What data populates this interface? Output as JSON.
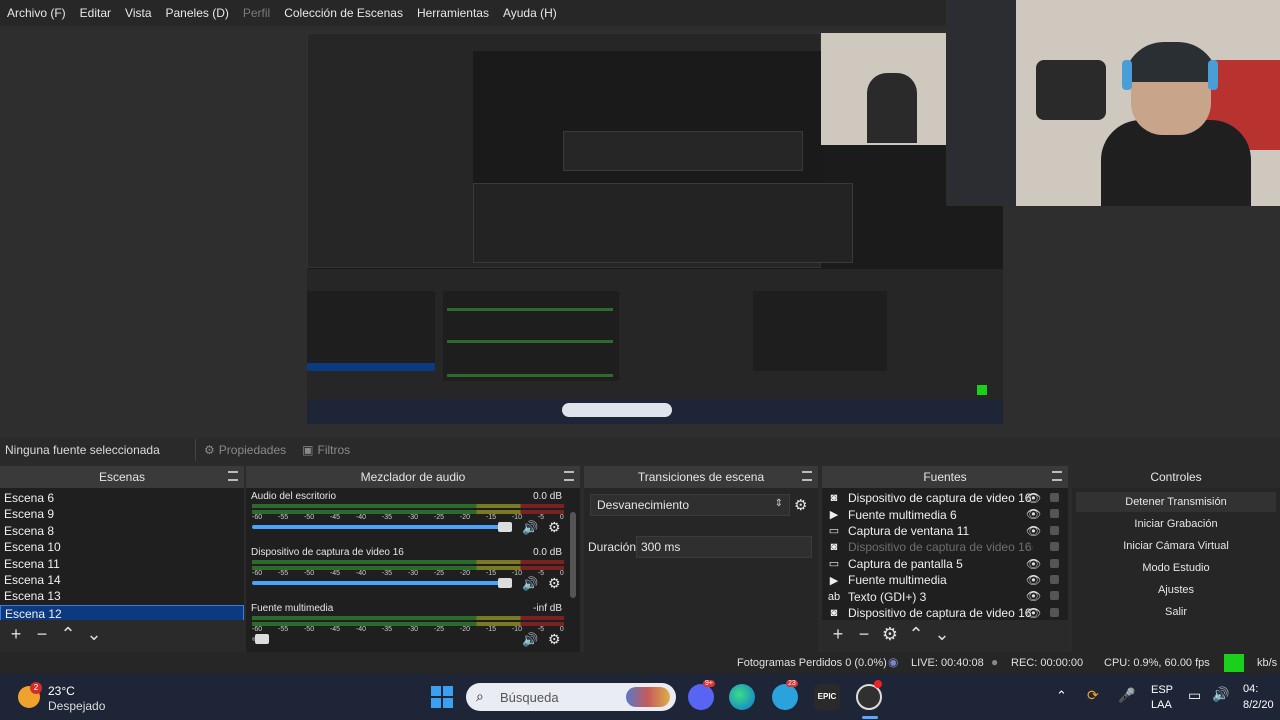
{
  "menubar": {
    "items": [
      {
        "label": "Archivo (F)",
        "disabled": false
      },
      {
        "label": "Editar",
        "disabled": false
      },
      {
        "label": "Vista",
        "disabled": false
      },
      {
        "label": "Paneles (D)",
        "disabled": false
      },
      {
        "label": "Perfil",
        "disabled": true
      },
      {
        "label": "Colección de Escenas",
        "disabled": false
      },
      {
        "label": "Herramientas",
        "disabled": false
      },
      {
        "label": "Ayuda (H)",
        "disabled": false
      }
    ]
  },
  "propbar": {
    "no_source": "Ninguna fuente seleccionada",
    "properties": "Propiedades",
    "filters": "Filtros"
  },
  "scenes": {
    "title": "Escenas",
    "items": [
      "Escena 6",
      "Escena 9",
      "Escena 8",
      "Escena 10",
      "Escena 11",
      "Escena 14",
      "Escena 13",
      "Escena 12"
    ],
    "selected": "Escena 12"
  },
  "mixer": {
    "title": "Mezclador de audio",
    "ticks": [
      "-60",
      "-55",
      "-50",
      "-45",
      "-40",
      "-35",
      "-30",
      "-25",
      "-20",
      "-15",
      "-10",
      "-5",
      "0"
    ],
    "channels": [
      {
        "name": "Audio del escritorio",
        "level": "0.0 dB",
        "volume_fraction": 1.0
      },
      {
        "name": "Dispositivo de captura de video 16",
        "level": "0.0 dB",
        "volume_fraction": 1.0
      },
      {
        "name": "Fuente multimedia",
        "level": "-inf dB",
        "volume_fraction": 0.05
      }
    ]
  },
  "transitions": {
    "title": "Transiciones de escena",
    "selected": "Desvanecimiento",
    "duration_label": "Duración",
    "duration_value": "300 ms"
  },
  "sources": {
    "title": "Fuentes",
    "items": [
      {
        "label": "Dispositivo de captura de video 16",
        "icon": "camera-icon",
        "visible": true
      },
      {
        "label": "Fuente multimedia 6",
        "icon": "play-icon",
        "visible": true
      },
      {
        "label": "Captura de ventana 11",
        "icon": "window-icon",
        "visible": true
      },
      {
        "label": "Dispositivo de captura de video 16",
        "icon": "camera-icon",
        "visible": false
      },
      {
        "label": "Captura de pantalla 5",
        "icon": "monitor-icon",
        "visible": true
      },
      {
        "label": "Fuente multimedia",
        "icon": "play-icon",
        "visible": true
      },
      {
        "label": "Texto (GDI+) 3",
        "icon": "text-icon",
        "visible": true
      },
      {
        "label": "Dispositivo de captura de video 16",
        "icon": "camera-icon",
        "visible": true
      }
    ]
  },
  "controls": {
    "title": "Controles",
    "buttons": [
      "Detener Transmisión",
      "Iniciar Grabación",
      "Iniciar Cámara Virtual",
      "Modo Estudio",
      "Ajustes",
      "Salir"
    ]
  },
  "status": {
    "dropped": "Fotogramas Perdidos 0 (0.0%)",
    "live": "LIVE: 00:40:08",
    "rec": "REC: 00:00:00",
    "cpu": "CPU: 0.9%, 60.00 fps",
    "bitrate": "kb/s",
    "stream_health_color": "#1ad01a"
  },
  "taskbar": {
    "weather_badge": "2",
    "temperature": "23°C",
    "condition": "Despejado",
    "search_placeholder": "Búsqueda",
    "discord_badge": "9+",
    "telegram_badge": "23",
    "epic_label": "EPIC",
    "lang": "ESP",
    "layout": "LAA",
    "time": "04:",
    "date": "8/2/20"
  }
}
